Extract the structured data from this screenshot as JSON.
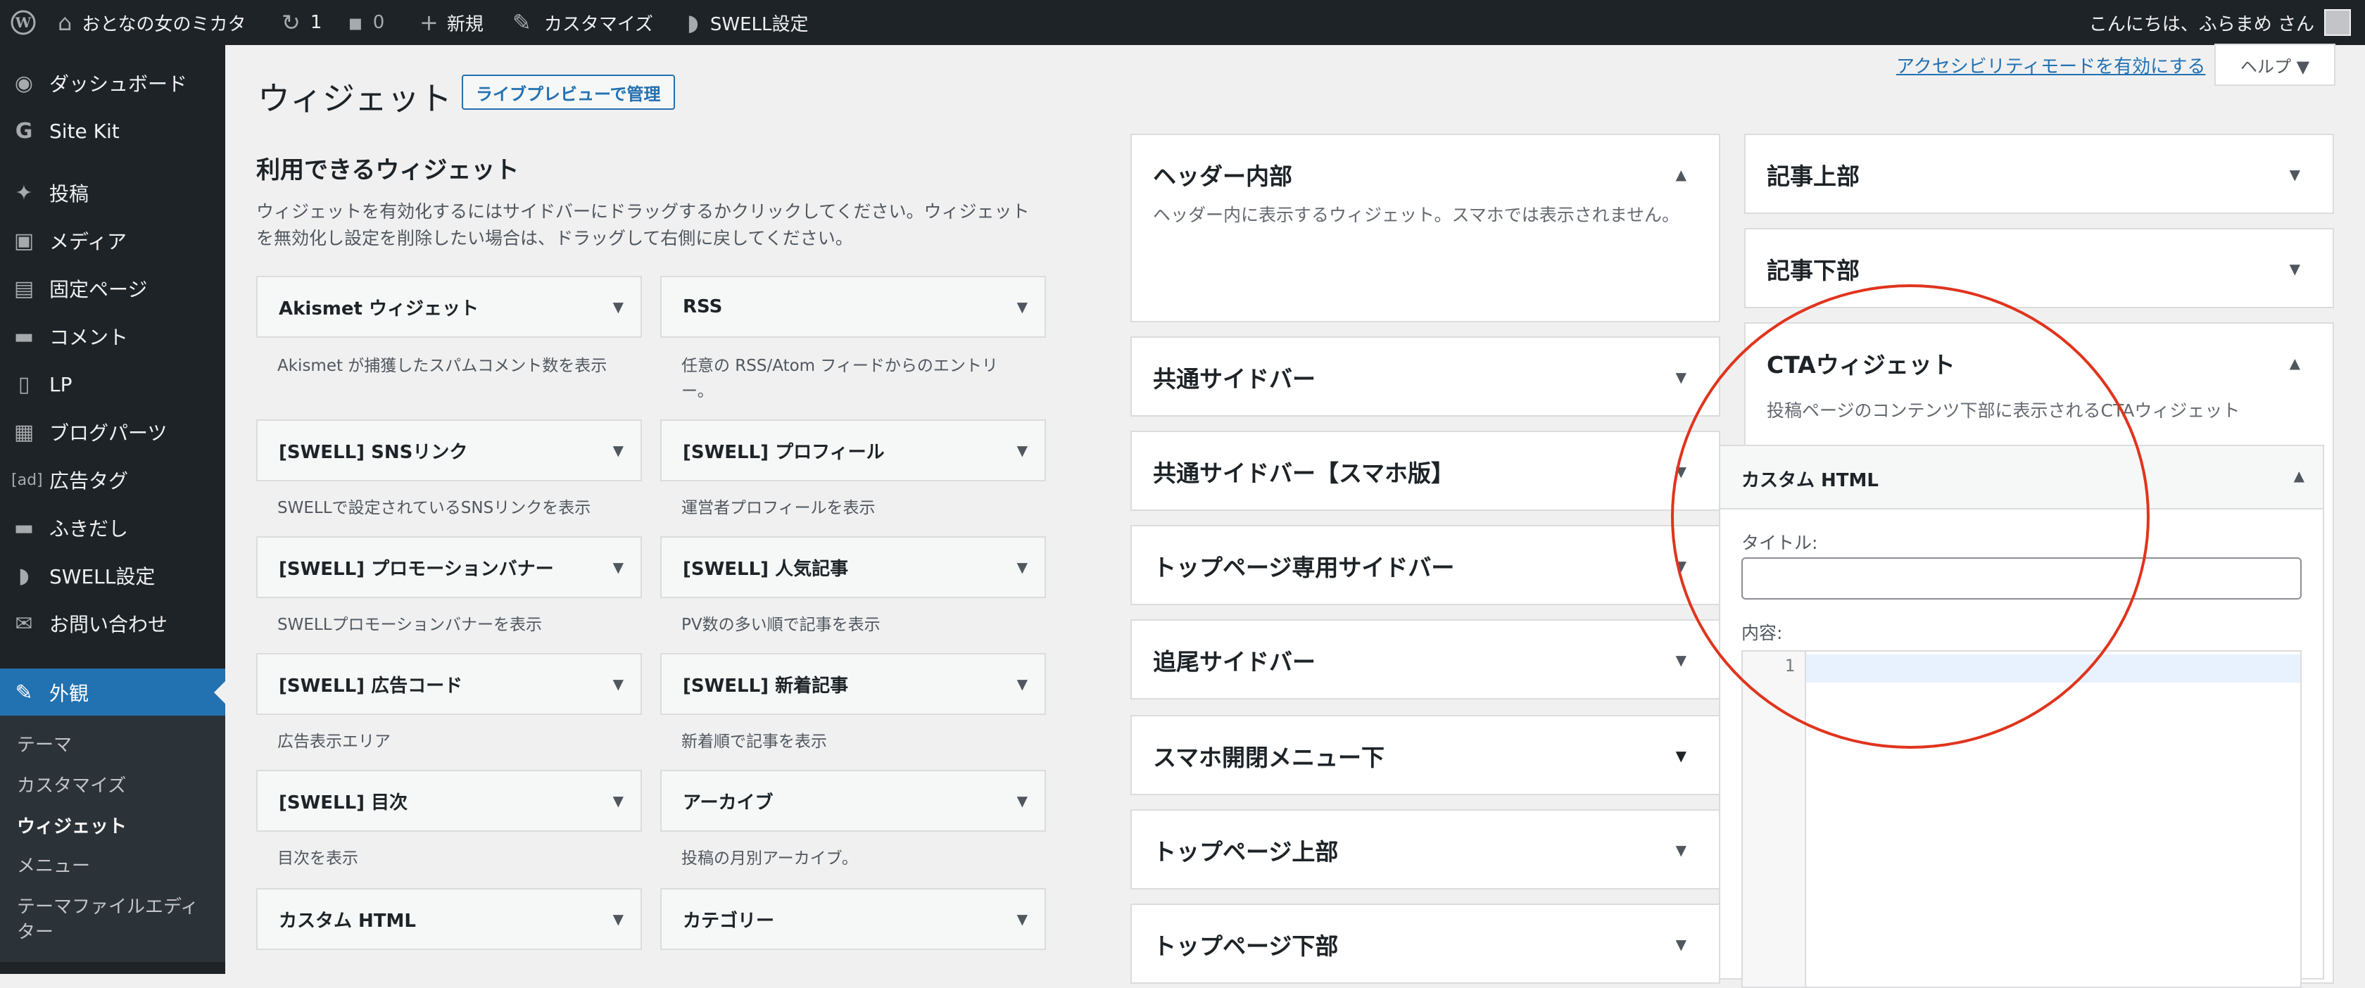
{
  "admin_bar": {
    "site_name": "おとなの女のミカタ",
    "updates_count": "1",
    "comments_count": "0",
    "new_label": "新規",
    "customize_label": "カスタマイズ",
    "swell_label": "SWELL設定",
    "greeting": "こんにちは、ふらまめ さん"
  },
  "sidebar": {
    "items": [
      {
        "label": "ダッシュボード",
        "icon": "dashboard-icon"
      },
      {
        "label": "Site Kit",
        "icon": "google-icon"
      },
      {
        "label": "投稿",
        "icon": "pin-icon"
      },
      {
        "label": "メディア",
        "icon": "media-icon"
      },
      {
        "label": "固定ページ",
        "icon": "page-icon"
      },
      {
        "label": "コメント",
        "icon": "comment-icon"
      },
      {
        "label": "LP",
        "icon": "document-icon"
      },
      {
        "label": "ブログパーツ",
        "icon": "grid-icon"
      },
      {
        "label": "広告タグ",
        "icon": "ad-icon"
      },
      {
        "label": "ふきだし",
        "icon": "bubble-icon"
      },
      {
        "label": "SWELL設定",
        "icon": "swell-icon"
      },
      {
        "label": "お問い合わせ",
        "icon": "mail-icon"
      },
      {
        "label": "外観",
        "icon": "brush-icon"
      }
    ],
    "ad_icon_text": "[ad]",
    "submenu": [
      "テーマ",
      "カスタマイズ",
      "ウィジェット",
      "メニュー",
      "テーマファイルエディ",
      "ター"
    ]
  },
  "page": {
    "title": "ウィジェット",
    "live_preview_button": "ライブプレビューで管理",
    "accessibility_link": "アクセシビリティモードを有効にする",
    "help_button": "ヘルプ ▼",
    "available_title": "利用できるウィジェット",
    "available_desc_1": "ウィジェットを有効化するにはサイドバーにドラッグするかクリックしてください。ウィジェット",
    "available_desc_2": "を無効化し設定を削除したい場合は、ドラッグして右側に戻してください。"
  },
  "widgets": [
    {
      "name": "Akismet ウィジェット",
      "desc": "Akismet が捕獲したスパムコメント数を表示",
      "desc2": ""
    },
    {
      "name": "RSS",
      "desc": "任意の RSS/Atom フィードからのエントリ",
      "desc2": "ー。"
    },
    {
      "name": "[SWELL] SNSリンク",
      "desc": "SWELLで設定されているSNSリンクを表示",
      "desc2": ""
    },
    {
      "name": "[SWELL] プロフィール",
      "desc": "運営者プロフィールを表示",
      "desc2": ""
    },
    {
      "name": "[SWELL] プロモーションバナー",
      "desc": "SWELLプロモーションバナーを表示",
      "desc2": ""
    },
    {
      "name": "[SWELL] 人気記事",
      "desc": "PV数の多い順で記事を表示",
      "desc2": ""
    },
    {
      "name": "[SWELL] 広告コード",
      "desc": "広告表示エリア",
      "desc2": ""
    },
    {
      "name": "[SWELL] 新着記事",
      "desc": "新着順で記事を表示",
      "desc2": ""
    },
    {
      "name": "[SWELL] 目次",
      "desc": "目次を表示",
      "desc2": ""
    },
    {
      "name": "アーカイブ",
      "desc": "投稿の月別アーカイブ。",
      "desc2": ""
    },
    {
      "name": "カスタム HTML",
      "desc": "",
      "desc2": ""
    },
    {
      "name": "カテゴリー",
      "desc": "",
      "desc2": ""
    }
  ],
  "sidebars_left": [
    {
      "title": "ヘッダー内部",
      "desc": "ヘッダー内に表示するウィジェット。スマホでは表示されません。"
    },
    {
      "title": "共通サイドバー"
    },
    {
      "title": "共通サイドバー【スマホ版】"
    },
    {
      "title": "トップページ専用サイドバー"
    },
    {
      "title": "追尾サイドバー"
    },
    {
      "title": "スマホ開閉メニュー下"
    },
    {
      "title": "トップページ上部"
    },
    {
      "title": "トップページ下部"
    }
  ],
  "sidebars_right": [
    {
      "title": "記事上部"
    },
    {
      "title": "記事下部"
    },
    {
      "title": "CTAウィジェット",
      "desc": "投稿ページのコンテンツ下部に表示されるCTAウィジェット"
    }
  ],
  "custom_html": {
    "title": "カスタム HTML",
    "title_label": "タイトル:",
    "title_value": "",
    "content_label": "内容:",
    "line_number": "1"
  },
  "colors": {
    "accent": "#2271b1",
    "admin_bg": "#1d2327",
    "highlight_circle": "#e0341d"
  }
}
